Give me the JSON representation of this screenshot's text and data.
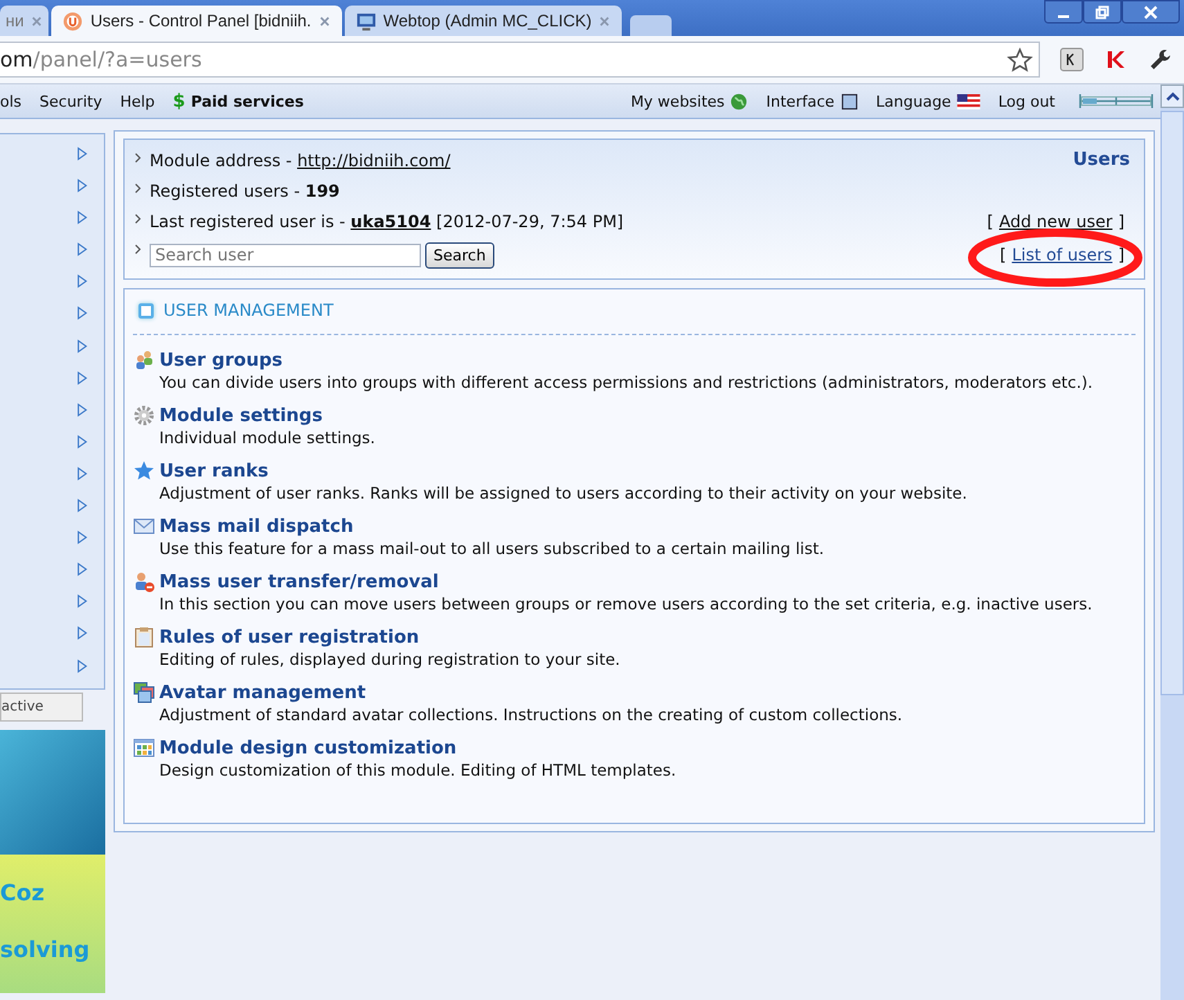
{
  "browser": {
    "tabs": [
      {
        "title": "ни",
        "selected": false,
        "kind": "plain"
      },
      {
        "title": "Users - Control Panel [bidniih.",
        "selected": true,
        "kind": "ucoz"
      },
      {
        "title": "Webtop (Admin MC_CLICK)",
        "selected": false,
        "kind": "monitor"
      }
    ],
    "address": {
      "host": "om",
      "path": "/panel/?a=users"
    }
  },
  "toolbar": {
    "left": [
      {
        "label": "ols",
        "kind": "plain"
      },
      {
        "label": "Security",
        "kind": "plain"
      },
      {
        "label": "Help",
        "kind": "plain"
      },
      {
        "label": "Paid services",
        "kind": "paid",
        "symbol": "$"
      }
    ],
    "right": [
      {
        "label": "My websites",
        "kind": "globe"
      },
      {
        "label": "Interface",
        "kind": "square"
      },
      {
        "label": "Language",
        "kind": "flag"
      },
      {
        "label": "Log out",
        "kind": "plain"
      }
    ]
  },
  "sidebar": {
    "items": [
      {
        "expanded": false
      },
      {
        "expanded": false
      },
      {
        "expanded": false
      },
      {
        "expanded": false
      },
      {
        "expanded": false
      },
      {
        "expanded": false
      },
      {
        "expanded": false
      },
      {
        "expanded": false
      },
      {
        "expanded": false
      },
      {
        "expanded": false
      },
      {
        "expanded": false
      },
      {
        "expanded": false
      },
      {
        "expanded": false
      },
      {
        "expanded": false
      },
      {
        "expanded": false
      },
      {
        "expanded": false
      },
      {
        "expanded": false
      }
    ],
    "button": "active",
    "banner": [
      "Coz",
      "solving"
    ]
  },
  "info": {
    "title": "Users",
    "address_label": "Module address - ",
    "address_link": "http://bidniih.com/",
    "registered_label": "Registered users - ",
    "registered_count": "199",
    "last_label": "Last registered user is - ",
    "last_user": "uka5104",
    "last_date": "[2012-07-29, 7:54 PM]",
    "search_placeholder": "Search user",
    "search_button": "Search",
    "links": [
      {
        "open": "[",
        "label": "Add new user",
        "close": "]",
        "circled": false
      },
      {
        "open": "[",
        "label": "List of users",
        "close": "]",
        "circled": true
      }
    ]
  },
  "management": {
    "title": "USER MANAGEMENT",
    "items": [
      {
        "kind": "users",
        "title": "User groups",
        "text": "You can divide users into groups with different access permissions and restrictions (administrators, moderators etc.)."
      },
      {
        "kind": "gear",
        "title": "Module settings",
        "text": "Individual module settings."
      },
      {
        "kind": "star",
        "title": "User ranks",
        "text": "Adjustment of user ranks. Ranks will be assigned to users according to their activity on your website."
      },
      {
        "kind": "mail",
        "title": "Mass mail dispatch",
        "text": "Use this feature for a mass mail-out to all users subscribed to a certain mailing list."
      },
      {
        "kind": "transfer",
        "title": "Mass user transfer/removal",
        "text": "In this section you can move users between groups or remove users according to the set criteria, e.g. inactive users."
      },
      {
        "kind": "clipboard",
        "title": "Rules of user registration",
        "text": "Editing of rules, displayed during registration to your site."
      },
      {
        "kind": "avatar",
        "title": "Avatar management",
        "text": "Adjustment of standard avatar collections. Instructions on the creating of custom collections."
      },
      {
        "kind": "grid",
        "title": "Module design customization",
        "text": "Design customization of this module. Editing of HTML templates."
      }
    ]
  }
}
